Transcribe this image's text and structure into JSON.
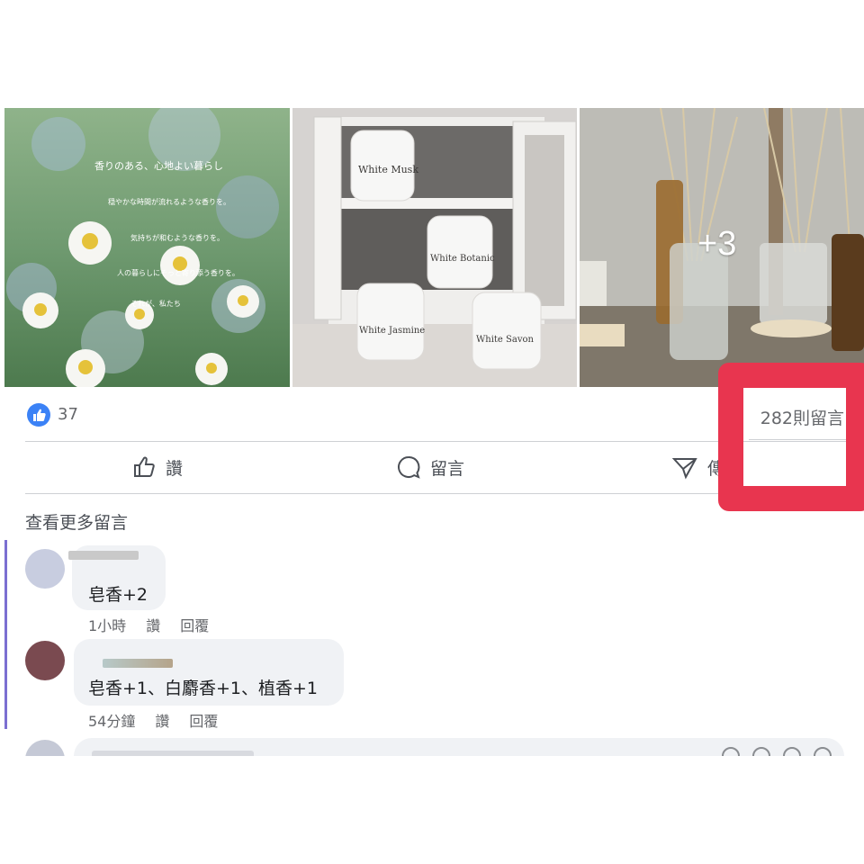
{
  "photos": {
    "more_count": "+3",
    "photo1": {
      "lines": [
        "香りのある、心地よい暮らし",
        "穏やかな時間が流れるような香りを。",
        "気持ちが和むような香りを。",
        "人の暮らしにそっと寄り添う香りを。",
        "それが、私たち"
      ]
    },
    "photo2": {
      "jars": [
        "White Musk",
        "White Botanic",
        "White Jasmine",
        "White Savon"
      ]
    }
  },
  "stats": {
    "like_count": "37",
    "comment_count": "282則留言"
  },
  "actions": {
    "like_label": "讚",
    "comment_label": "留言",
    "share_label": "傳"
  },
  "comments_section": {
    "more_comments": "查看更多留言",
    "comments": [
      {
        "text": "皂香+2",
        "time": "1小時",
        "like": "讚",
        "reply": "回覆"
      },
      {
        "text": "皂香+1、白麝香+1、植香+1",
        "time": "54分鐘",
        "like": "讚",
        "reply": "回覆"
      }
    ]
  },
  "colors": {
    "highlight": "#e8354f",
    "like_blue": "#1877f2",
    "thread_line": "#7b6fd1"
  },
  "icons": [
    "like-badge-icon",
    "thumbs-up-icon",
    "comment-icon",
    "share-icon"
  ]
}
